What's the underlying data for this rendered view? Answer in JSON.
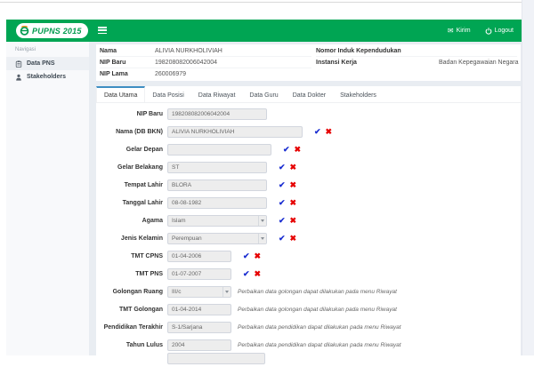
{
  "navbar": {
    "logo_text": "PUPNS 2015",
    "kirim_label": "Kirim",
    "logout_label": "Logout",
    "envelope_glyph": "✉",
    "brand_green": "#00a553",
    "tab_accent_blue": "#3e8ec2"
  },
  "sidebar": {
    "heading": "Navigasi",
    "items": [
      {
        "label": "Data PNS",
        "icon": "clipboard-icon",
        "active": true
      },
      {
        "label": "Stakeholders",
        "icon": "user-icon",
        "active": false
      }
    ]
  },
  "summary": {
    "left": [
      {
        "label": "Nama",
        "value": "ALIVIA NURKHOLIVIAH"
      },
      {
        "label": "NIP Baru",
        "value": "198208082006042004"
      },
      {
        "label": "NIP Lama",
        "value": "260006979"
      }
    ],
    "right": [
      {
        "label": "Nomor Induk Kependudukan",
        "value": ""
      },
      {
        "label": "Instansi Kerja",
        "value": "Badan Kepegawaian Negara"
      }
    ]
  },
  "tabs": [
    {
      "label": "Data Utama",
      "active": true
    },
    {
      "label": "Data Posisi",
      "active": false
    },
    {
      "label": "Data Riwayat",
      "active": false
    },
    {
      "label": "Data Guru",
      "active": false
    },
    {
      "label": "Data Dokter",
      "active": false
    },
    {
      "label": "Stakeholders",
      "active": false
    }
  ],
  "icons": {
    "check": "✔",
    "cross": "✖"
  },
  "form": {
    "fields": [
      {
        "label": "NIP Baru",
        "value": "198208082006042004"
      },
      {
        "label": "Nama (DB BKN)",
        "value": "ALIVIA NURKHOLIVIAH"
      },
      {
        "label": "Gelar Depan",
        "value": ""
      },
      {
        "label": "Gelar Belakang",
        "value": "ST"
      },
      {
        "label": "Tempat Lahir",
        "value": "BLORA"
      },
      {
        "label": "Tanggal Lahir",
        "value": "08-08-1982"
      },
      {
        "label": "Agama",
        "value": "Islam"
      },
      {
        "label": "Jenis Kelamin",
        "value": "Perempuan"
      },
      {
        "label": "TMT CPNS",
        "value": "01-04-2006"
      },
      {
        "label": "TMT PNS",
        "value": "01-07-2007"
      },
      {
        "label": "Golongan Ruang",
        "value": "III/c",
        "note": "Perbaikan data golongan dapat dilakukan pada menu Riwayat"
      },
      {
        "label": "TMT Golongan",
        "value": "01-04-2014",
        "note": "Perbaikan data golongan dapat dilakukan pada menu Riwayat"
      },
      {
        "label": "Pendidikan Terakhir",
        "value": "S-1/Sarjana",
        "note": "Perbaikan data pendidikan dapat dilakukan pada menu Riwayat"
      },
      {
        "label": "Tahun Lulus",
        "value": "2004",
        "note": "Perbaikan data pendidikan dapat dilakukan pada menu Riwayat"
      },
      {
        "label": "",
        "value": ""
      }
    ]
  }
}
